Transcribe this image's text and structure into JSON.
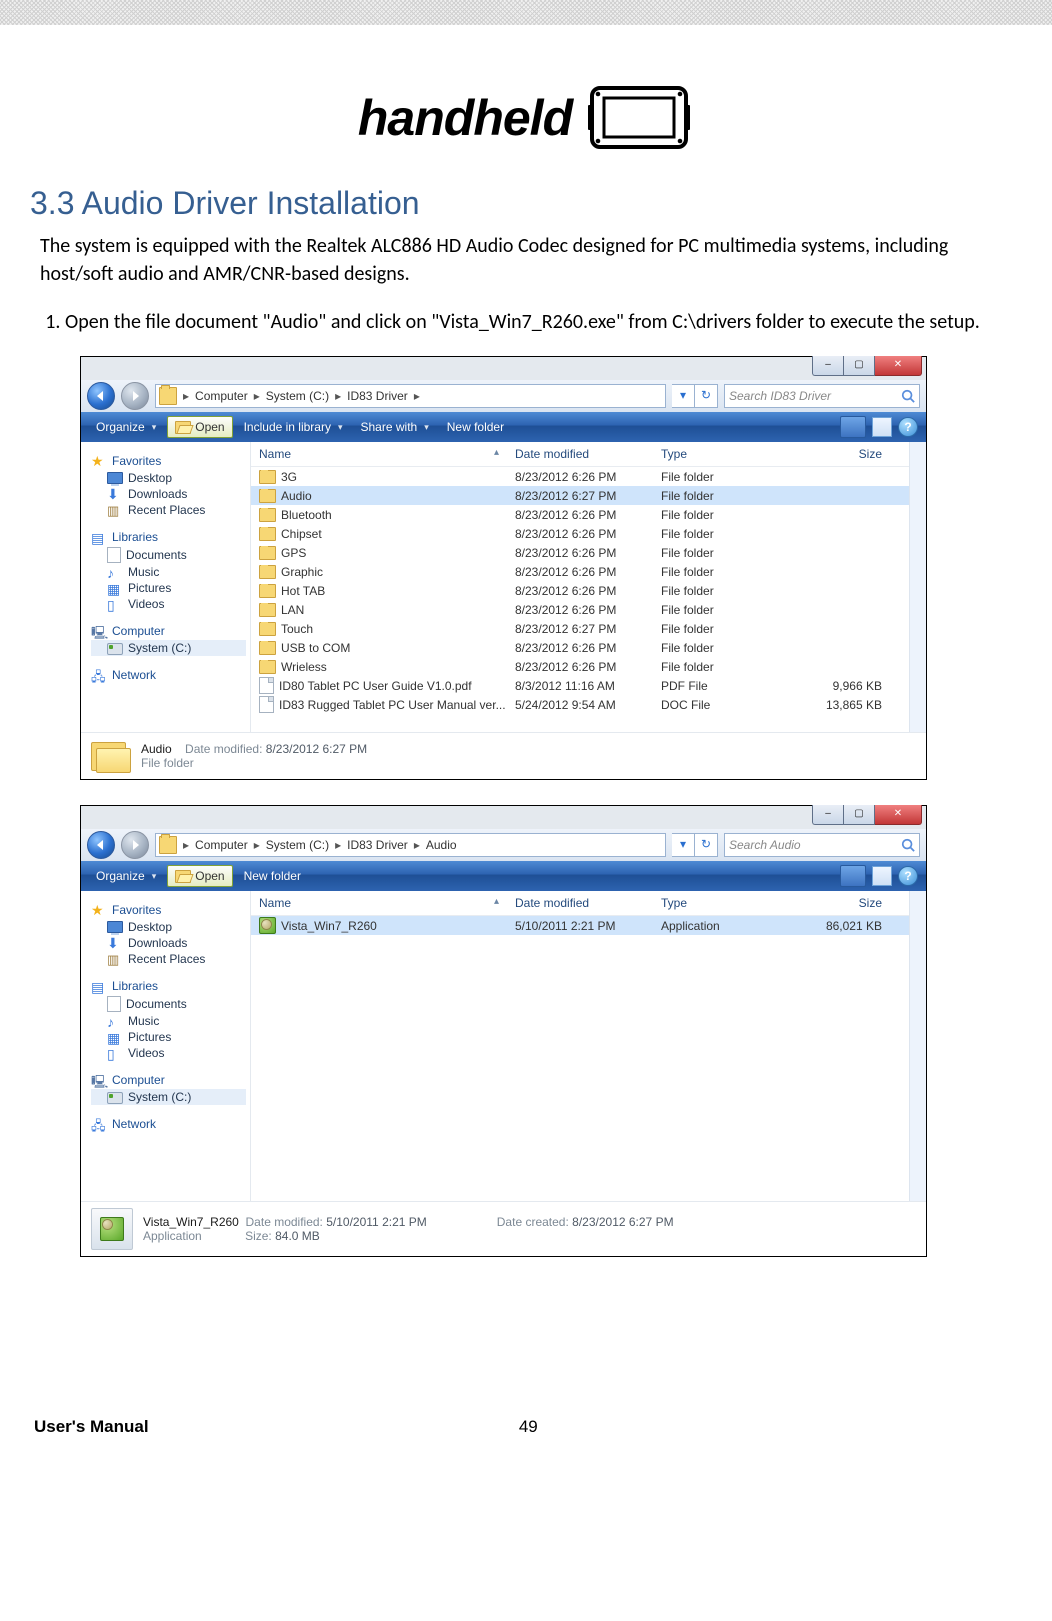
{
  "header": {
    "brand": "handheld"
  },
  "section": {
    "title": "3.3  Audio Driver Installation"
  },
  "intro": "The system is equipped with the Realtek ALC886 HD Audio Codec designed for PC multimedia systems, including host/soft audio and AMR/CNR-based designs.",
  "step1": "Open the file document \"Audio\" and click on \"Vista_Win7_R260.exe\" from C:\\drivers folder to execute the setup.",
  "explorer1": {
    "address": {
      "crumbs": [
        "Computer",
        "System (C:)",
        "ID83 Driver"
      ]
    },
    "search_placeholder": "Search ID83 Driver",
    "toolbar": {
      "organize": "Organize",
      "open": "Open",
      "include": "Include in library",
      "share": "Share with",
      "newfolder": "New folder"
    },
    "nav": {
      "favorites": "Favorites",
      "desktop": "Desktop",
      "downloads": "Downloads",
      "recent": "Recent Places",
      "libraries": "Libraries",
      "documents": "Documents",
      "music": "Music",
      "pictures": "Pictures",
      "videos": "Videos",
      "computer": "Computer",
      "systemc": "System (C:)",
      "network": "Network"
    },
    "cols": {
      "name": "Name",
      "date": "Date modified",
      "type": "Type",
      "size": "Size"
    },
    "rows": [
      {
        "kind": "folder",
        "name": "3G",
        "date": "8/23/2012 6:26 PM",
        "type": "File folder",
        "size": ""
      },
      {
        "kind": "folder",
        "name": "Audio",
        "date": "8/23/2012 6:27 PM",
        "type": "File folder",
        "size": "",
        "selected": true
      },
      {
        "kind": "folder",
        "name": "Bluetooth",
        "date": "8/23/2012 6:26 PM",
        "type": "File folder",
        "size": ""
      },
      {
        "kind": "folder",
        "name": "Chipset",
        "date": "8/23/2012 6:26 PM",
        "type": "File folder",
        "size": ""
      },
      {
        "kind": "folder",
        "name": "GPS",
        "date": "8/23/2012 6:26 PM",
        "type": "File folder",
        "size": ""
      },
      {
        "kind": "folder",
        "name": "Graphic",
        "date": "8/23/2012 6:26 PM",
        "type": "File folder",
        "size": ""
      },
      {
        "kind": "folder",
        "name": "Hot TAB",
        "date": "8/23/2012 6:26 PM",
        "type": "File folder",
        "size": ""
      },
      {
        "kind": "folder",
        "name": "LAN",
        "date": "8/23/2012 6:26 PM",
        "type": "File folder",
        "size": ""
      },
      {
        "kind": "folder",
        "name": "Touch",
        "date": "8/23/2012 6:27 PM",
        "type": "File folder",
        "size": ""
      },
      {
        "kind": "folder",
        "name": "USB to COM",
        "date": "8/23/2012 6:26 PM",
        "type": "File folder",
        "size": ""
      },
      {
        "kind": "folder",
        "name": "Wrieless",
        "date": "8/23/2012 6:26 PM",
        "type": "File folder",
        "size": ""
      },
      {
        "kind": "file",
        "name": "ID80 Tablet PC User Guide V1.0.pdf",
        "date": "8/3/2012 11:16 AM",
        "type": "PDF File",
        "size": "9,966 KB"
      },
      {
        "kind": "file",
        "name": "ID83 Rugged Tablet PC  User Manual ver...",
        "date": "5/24/2012 9:54 AM",
        "type": "DOC File",
        "size": "13,865 KB"
      }
    ],
    "details": {
      "name": "Audio",
      "type": "File folder",
      "mod_label": "Date modified:",
      "mod_value": "8/23/2012 6:27 PM"
    }
  },
  "explorer2": {
    "address": {
      "crumbs": [
        "Computer",
        "System (C:)",
        "ID83 Driver",
        "Audio"
      ]
    },
    "search_placeholder": "Search Audio",
    "toolbar": {
      "organize": "Organize",
      "open": "Open",
      "newfolder": "New folder"
    },
    "nav": {
      "favorites": "Favorites",
      "desktop": "Desktop",
      "downloads": "Downloads",
      "recent": "Recent Places",
      "libraries": "Libraries",
      "documents": "Documents",
      "music": "Music",
      "pictures": "Pictures",
      "videos": "Videos",
      "computer": "Computer",
      "systemc": "System (C:)",
      "network": "Network"
    },
    "cols": {
      "name": "Name",
      "date": "Date modified",
      "type": "Type",
      "size": "Size"
    },
    "rows": [
      {
        "kind": "app",
        "name": "Vista_Win7_R260",
        "date": "5/10/2011 2:21 PM",
        "type": "Application",
        "size": "86,021 KB",
        "selected": true
      }
    ],
    "details": {
      "name": "Vista_Win7_R260",
      "type": "Application",
      "mod_label": "Date modified:",
      "mod_value": "5/10/2011 2:21 PM",
      "size_label": "Size:",
      "size_value": "84.0 MB",
      "created_label": "Date created:",
      "created_value": "8/23/2012 6:27 PM"
    }
  },
  "footer": {
    "left": "User's Manual",
    "page": "49"
  }
}
